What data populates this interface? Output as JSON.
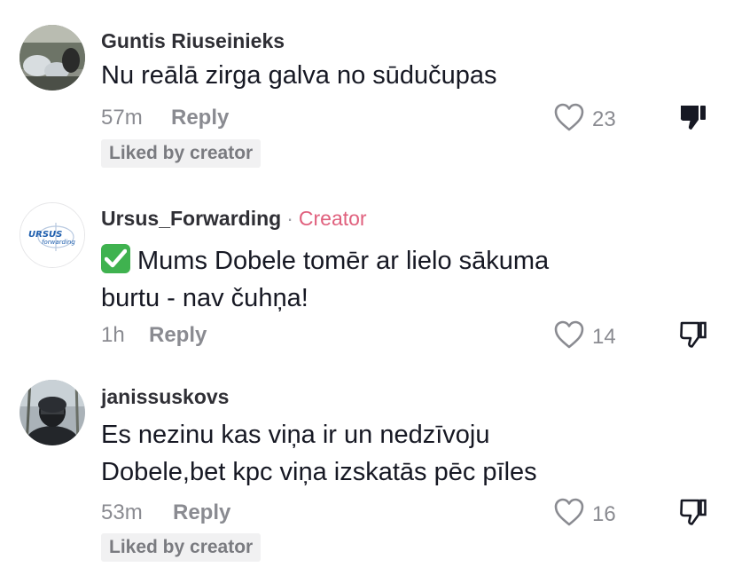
{
  "comments": [
    {
      "username": "Guntis Riuseinieks",
      "text": "Nu reālā zirga galva no sūdučupas",
      "time": "57m",
      "reply_label": "Reply",
      "likes": "23",
      "liked_by_creator": "Liked by creator",
      "disliked": true
    },
    {
      "username": "Ursus_Forwarding",
      "creator_separator": "·",
      "creator_label": "Creator",
      "avatar_logo_top": "URSUS",
      "avatar_logo_bottom": "forwarding",
      "text_line1": "Mums Dobele tomēr ar lielo sākuma",
      "text_line2": "burtu - nav čuhņa!",
      "time": "1h",
      "reply_label": "Reply",
      "likes": "14",
      "disliked": false
    },
    {
      "username": "janissuskovs",
      "text_line1": "Es nezinu kas viņa ir un nedzīvoju",
      "text_line2": "Dobele,bet kpc viņa izskatās pēc pīles",
      "time": "53m",
      "reply_label": "Reply",
      "likes": "16",
      "liked_by_creator": "Liked by creator",
      "disliked": false
    }
  ],
  "icons": {
    "like": "heart-outline-icon",
    "dislike_filled": "thumbs-down-filled-icon",
    "dislike": "thumbs-down-outline-icon",
    "check": "check-mark-button-emoji"
  },
  "colors": {
    "creator": "#e0607d",
    "meta": "#8a8b91",
    "badge_bg": "#f1f1f2"
  }
}
